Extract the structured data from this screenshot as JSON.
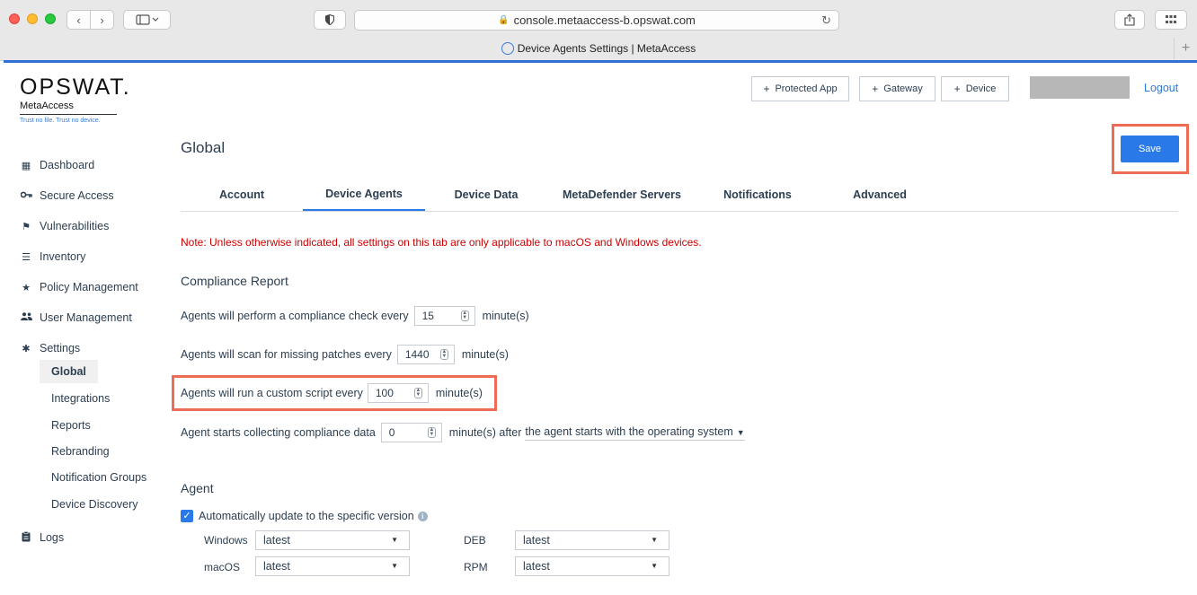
{
  "browser": {
    "url": "console.metaaccess-b.opswat.com",
    "tab_title": "Device Agents Settings | MetaAccess",
    "back": "‹",
    "forward": "›",
    "new_tab": "+"
  },
  "brand": {
    "logo": "OPSWAT.",
    "product": "MetaAccess",
    "tagline": "Trust no file. Trust no device."
  },
  "sidebar": {
    "items": [
      {
        "label": "Dashboard",
        "icon": "grid-icon"
      },
      {
        "label": "Secure Access",
        "icon": "key-icon"
      },
      {
        "label": "Vulnerabilities",
        "icon": "flag-icon"
      },
      {
        "label": "Inventory",
        "icon": "list-icon"
      },
      {
        "label": "Policy Management",
        "icon": "star-icon"
      },
      {
        "label": "User Management",
        "icon": "users-icon"
      },
      {
        "label": "Settings",
        "icon": "gear-icon"
      }
    ],
    "settings_sub": [
      "Global",
      "Integrations",
      "Reports",
      "Rebranding",
      "Notification Groups",
      "Device Discovery"
    ],
    "logs": {
      "label": "Logs",
      "icon": "clipboard-icon"
    }
  },
  "header": {
    "buttons": [
      "Protected App",
      "Gateway",
      "Device"
    ],
    "logout": "Logout",
    "save": "Save"
  },
  "page": {
    "title": "Global",
    "tabs": [
      "Account",
      "Device Agents",
      "Device Data",
      "MetaDefender Servers",
      "Notifications",
      "Advanced"
    ],
    "active_tab": "Device Agents",
    "note": "Note: Unless otherwise indicated, all settings on this tab are only applicable to macOS and Windows devices."
  },
  "compliance": {
    "heading": "Compliance Report",
    "check": {
      "label": "Agents will perform a compliance check every",
      "value": "15",
      "unit": "minute(s)"
    },
    "patches": {
      "label": "Agents will scan for missing patches every",
      "value": "1440",
      "unit": "minute(s)"
    },
    "script": {
      "label": "Agents will run a custom script every",
      "value": "100",
      "unit": "minute(s)"
    },
    "collect": {
      "label": "Agent starts collecting compliance data",
      "value": "0",
      "unit": "minute(s) after",
      "trigger": "the agent starts with the operating system"
    }
  },
  "agent": {
    "heading": "Agent",
    "auto_update": "Automatically update to the specific version",
    "auto_update_checked": true,
    "versions": [
      {
        "os": "Windows",
        "value": "latest"
      },
      {
        "os": "macOS",
        "value": "latest"
      },
      {
        "os": "DEB",
        "value": "latest"
      },
      {
        "os": "RPM",
        "value": "latest"
      }
    ]
  }
}
